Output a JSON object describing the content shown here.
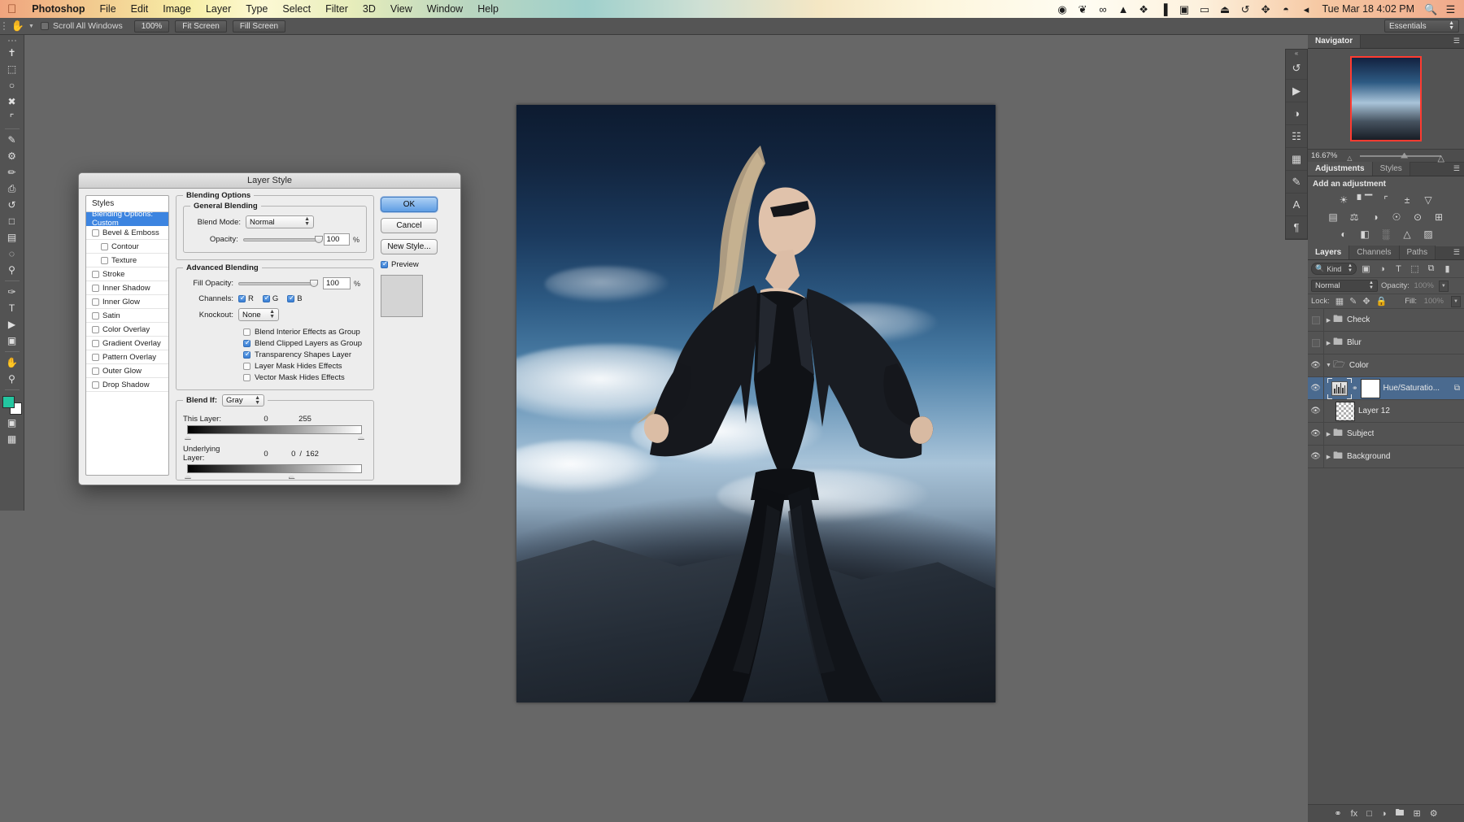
{
  "menubar": {
    "apple_icon": "apple-logo",
    "app_name": "Photoshop",
    "items": [
      "File",
      "Edit",
      "Image",
      "Layer",
      "Type",
      "Select",
      "Filter",
      "3D",
      "View",
      "Window",
      "Help"
    ],
    "status_icons": [
      {
        "name": "record-icon",
        "glyph": "◉"
      },
      {
        "name": "evernote-icon",
        "glyph": "❦"
      },
      {
        "name": "creative-cloud-icon",
        "glyph": "∞"
      },
      {
        "name": "google-drive-icon",
        "glyph": "▲"
      },
      {
        "name": "dropbox-icon",
        "glyph": "❖"
      },
      {
        "name": "equalizer-icon",
        "glyph": "▐"
      },
      {
        "name": "grid-icon",
        "glyph": "▣"
      },
      {
        "name": "airplay-icon",
        "glyph": "▭"
      },
      {
        "name": "eject-icon",
        "glyph": "⏏"
      },
      {
        "name": "timemachine-icon",
        "glyph": "↺"
      },
      {
        "name": "move-icon",
        "glyph": "✥"
      },
      {
        "name": "wifi-icon",
        "glyph": "◓"
      },
      {
        "name": "volume-icon",
        "glyph": "◂"
      }
    ],
    "clock": "Tue Mar 18  4:02 PM",
    "spotlight_icon": "search-icon",
    "notifications_icon": "list-icon"
  },
  "options_bar": {
    "tool_icon": "hand-tool-icon",
    "scroll_all_windows": "Scroll All Windows",
    "scroll_all_windows_checked": false,
    "buttons": [
      "100%",
      "Fit Screen",
      "Fill Screen"
    ],
    "workspace": "Essentials"
  },
  "toolbar": {
    "tools": [
      {
        "name": "move-tool",
        "glyph": "✥"
      },
      {
        "name": "marquee-tool",
        "glyph": "⬚"
      },
      {
        "name": "lasso-tool",
        "glyph": "❀"
      },
      {
        "name": "quick-selection-tool",
        "glyph": "✒"
      },
      {
        "name": "crop-tool",
        "glyph": "⌗"
      },
      {
        "name": "eyedropper-tool",
        "glyph": "✒"
      },
      {
        "name": "spot-healing-tool",
        "glyph": "⚖"
      },
      {
        "name": "brush-tool",
        "glyph": "✎"
      },
      {
        "name": "clone-stamp-tool",
        "glyph": "⎙"
      },
      {
        "name": "history-brush-tool",
        "glyph": "↺"
      },
      {
        "name": "eraser-tool",
        "glyph": "▱"
      },
      {
        "name": "gradient-tool",
        "glyph": "▤"
      },
      {
        "name": "blur-tool",
        "glyph": "◌"
      },
      {
        "name": "dodge-tool",
        "glyph": "⚲"
      },
      {
        "name": "pen-tool",
        "glyph": "✑"
      },
      {
        "name": "type-tool",
        "glyph": "T"
      },
      {
        "name": "path-selection-tool",
        "glyph": "↖"
      },
      {
        "name": "rectangle-tool",
        "glyph": "▣"
      },
      {
        "name": "hand-tool",
        "glyph": "✋"
      },
      {
        "name": "zoom-tool",
        "glyph": "⚲"
      }
    ],
    "foreground_color": "#23c6a0",
    "background_color": "#ffffff",
    "quick_mask_icon": "quick-mask-icon",
    "screen_mode_icon": "screen-mode-icon"
  },
  "dialog": {
    "title": "Layer Style",
    "styles_header": "Styles",
    "styles": [
      {
        "label": "Blending Options: Custom",
        "selected": true,
        "checkbox": false,
        "indent": false
      },
      {
        "label": "Bevel & Emboss",
        "selected": false,
        "checkbox": true,
        "checked": false,
        "indent": false
      },
      {
        "label": "Contour",
        "selected": false,
        "checkbox": true,
        "checked": false,
        "indent": true
      },
      {
        "label": "Texture",
        "selected": false,
        "checkbox": true,
        "checked": false,
        "indent": true
      },
      {
        "label": "Stroke",
        "selected": false,
        "checkbox": true,
        "checked": false,
        "indent": false
      },
      {
        "label": "Inner Shadow",
        "selected": false,
        "checkbox": true,
        "checked": false,
        "indent": false
      },
      {
        "label": "Inner Glow",
        "selected": false,
        "checkbox": true,
        "checked": false,
        "indent": false
      },
      {
        "label": "Satin",
        "selected": false,
        "checkbox": true,
        "checked": false,
        "indent": false
      },
      {
        "label": "Color Overlay",
        "selected": false,
        "checkbox": true,
        "checked": false,
        "indent": false
      },
      {
        "label": "Gradient Overlay",
        "selected": false,
        "checkbox": true,
        "checked": false,
        "indent": false
      },
      {
        "label": "Pattern Overlay",
        "selected": false,
        "checkbox": true,
        "checked": false,
        "indent": false
      },
      {
        "label": "Outer Glow",
        "selected": false,
        "checkbox": true,
        "checked": false,
        "indent": false
      },
      {
        "label": "Drop Shadow",
        "selected": false,
        "checkbox": true,
        "checked": false,
        "indent": false
      }
    ],
    "blending_options_label": "Blending Options",
    "general_blending": {
      "label": "General Blending",
      "blend_mode_label": "Blend Mode:",
      "blend_mode_value": "Normal",
      "opacity_label": "Opacity:",
      "opacity_value": "100",
      "opacity_unit": "%"
    },
    "advanced_blending": {
      "label": "Advanced Blending",
      "fill_opacity_label": "Fill Opacity:",
      "fill_opacity_value": "100",
      "fill_opacity_unit": "%",
      "channels_label": "Channels:",
      "channels": [
        {
          "label": "R",
          "checked": true
        },
        {
          "label": "G",
          "checked": true
        },
        {
          "label": "B",
          "checked": true
        }
      ],
      "knockout_label": "Knockout:",
      "knockout_value": "None",
      "options": [
        {
          "label": "Blend Interior Effects as Group",
          "checked": false
        },
        {
          "label": "Blend Clipped Layers as Group",
          "checked": true
        },
        {
          "label": "Transparency Shapes Layer",
          "checked": true
        },
        {
          "label": "Layer Mask Hides Effects",
          "checked": false
        },
        {
          "label": "Vector Mask Hides Effects",
          "checked": false
        }
      ]
    },
    "blend_if": {
      "label": "Blend If:",
      "channel": "Gray",
      "this_layer_label": "This Layer:",
      "this_layer_black": "0",
      "this_layer_white": "255",
      "underlying_layer_label": "Underlying Layer:",
      "underlying_black": "0",
      "underlying_white_a": "0",
      "underlying_white_b": "162",
      "separator": "/"
    },
    "buttons": {
      "ok": "OK",
      "cancel": "Cancel",
      "new_style": "New Style...",
      "preview": "Preview",
      "preview_checked": true
    }
  },
  "navigator": {
    "tab": "Navigator",
    "zoom": "16.67%",
    "menu_icon": "panel-menu-icon",
    "collapse_icon": "collapse-panels-icon"
  },
  "adjustments": {
    "tabs": [
      "Adjustments",
      "Styles"
    ],
    "active_tab": "Adjustments",
    "title": "Add an adjustment",
    "rows": [
      [
        {
          "name": "brightness-contrast-icon",
          "glyph": "☀"
        },
        {
          "name": "levels-icon",
          "glyph": "ᵟ"
        },
        {
          "name": "curves-icon",
          "glyph": "⌇"
        },
        {
          "name": "exposure-icon",
          "glyph": "±"
        },
        {
          "name": "vibrance-icon",
          "glyph": "▽"
        }
      ],
      [
        {
          "name": "hue-saturation-icon",
          "glyph": "▤"
        },
        {
          "name": "color-balance-icon",
          "glyph": "⚖"
        },
        {
          "name": "black-white-icon",
          "glyph": "◑"
        },
        {
          "name": "photo-filter-icon",
          "glyph": "☉"
        },
        {
          "name": "channel-mixer-icon",
          "glyph": "⊙"
        },
        {
          "name": "color-lookup-icon",
          "glyph": "⊞"
        }
      ],
      [
        {
          "name": "invert-icon",
          "glyph": "◐"
        },
        {
          "name": "posterize-icon",
          "glyph": "◧"
        },
        {
          "name": "threshold-icon",
          "glyph": "░"
        },
        {
          "name": "gradient-map-icon",
          "glyph": "△"
        },
        {
          "name": "selective-color-icon",
          "glyph": "▨"
        }
      ]
    ]
  },
  "layers_panel": {
    "tabs": [
      "Layers",
      "Channels",
      "Paths"
    ],
    "active_tab": "Layers",
    "filter": {
      "search_icon": "search-icon",
      "kind_label": "Kind",
      "icons": [
        {
          "name": "filter-pixel-icon",
          "glyph": "▣"
        },
        {
          "name": "filter-adjustment-icon",
          "glyph": "◑"
        },
        {
          "name": "filter-type-icon",
          "glyph": "T"
        },
        {
          "name": "filter-shape-icon",
          "glyph": "⬚"
        },
        {
          "name": "filter-smart-object-icon",
          "glyph": "⧉"
        },
        {
          "name": "filter-toggle-icon",
          "glyph": "▮"
        }
      ]
    },
    "blend_mode": "Normal",
    "opacity_label": "Opacity:",
    "opacity_value": "100%",
    "lock_label": "Lock:",
    "lock_icons": [
      {
        "name": "lock-transparency-icon",
        "glyph": "▦"
      },
      {
        "name": "lock-image-icon",
        "glyph": "✎"
      },
      {
        "name": "lock-position-icon",
        "glyph": "✥"
      },
      {
        "name": "lock-all-icon",
        "glyph": "🔒"
      }
    ],
    "fill_label": "Fill:",
    "fill_value": "100%",
    "layers": [
      {
        "name": "Check",
        "type": "group",
        "visible": false,
        "expanded": false,
        "selected": false
      },
      {
        "name": "Blur",
        "type": "group",
        "visible": false,
        "expanded": false,
        "selected": false
      },
      {
        "name": "Color",
        "type": "group",
        "visible": true,
        "expanded": true,
        "selected": false
      },
      {
        "name": "Hue/Saturatio...",
        "type": "adjustment",
        "visible": true,
        "selected": true,
        "clipped": true
      },
      {
        "name": "Layer 12",
        "type": "pixel",
        "visible": true,
        "selected": false
      },
      {
        "name": "Subject",
        "type": "group",
        "visible": true,
        "expanded": false,
        "selected": false
      },
      {
        "name": "Background",
        "type": "group",
        "visible": true,
        "expanded": false,
        "selected": false
      }
    ],
    "bottom_icons": [
      {
        "name": "link-layers-icon",
        "glyph": "⚭"
      },
      {
        "name": "add-layer-style-icon",
        "glyph": "fx"
      },
      {
        "name": "add-layer-mask-icon",
        "glyph": "□"
      },
      {
        "name": "new-fill-adjustment-icon",
        "glyph": "◑"
      },
      {
        "name": "new-group-icon",
        "glyph": "▱"
      },
      {
        "name": "new-layer-icon",
        "glyph": "⊞"
      },
      {
        "name": "delete-layer-icon",
        "glyph": "🗑"
      }
    ]
  },
  "dock_strip": {
    "icons": [
      {
        "name": "history-panel-icon",
        "glyph": "↺"
      },
      {
        "name": "actions-panel-icon",
        "glyph": "▶"
      },
      {
        "name": "color-panel-icon",
        "glyph": "◑"
      },
      {
        "name": "properties-panel-icon",
        "glyph": "☷"
      },
      {
        "name": "swatches-panel-icon",
        "glyph": "▦"
      },
      {
        "name": "brush-panel-icon",
        "glyph": "✒"
      },
      {
        "name": "character-panel-icon",
        "glyph": "A"
      },
      {
        "name": "paragraph-panel-icon",
        "glyph": "¶"
      }
    ]
  }
}
